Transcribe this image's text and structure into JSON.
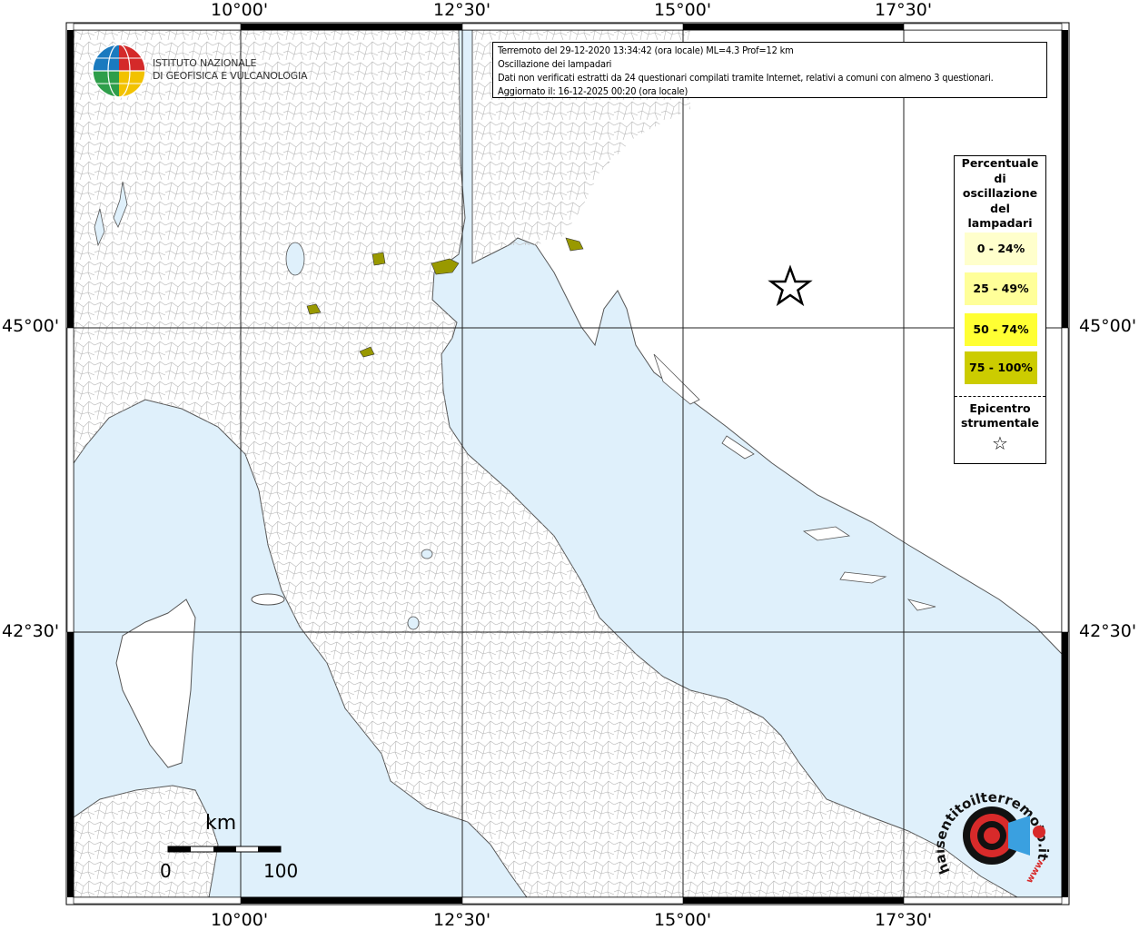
{
  "map": {
    "axis_labels": {
      "top": [
        "10°00'",
        "12°30'",
        "15°00'",
        "17°30'"
      ],
      "bottom": [
        "10°00'",
        "12°30'",
        "15°00'",
        "17°30'"
      ],
      "left": [
        "45°00'",
        "42°30'"
      ],
      "right": [
        "45°00'",
        "42°30'"
      ]
    },
    "colors": {
      "sea": "#dff0fb",
      "land": "#ffffff",
      "class_0_24": "#ffffcc",
      "class_25_49": "#ffff99",
      "class_50_74": "#ffff33",
      "class_75_100": "#cccc00",
      "affected_area": "#999900"
    }
  },
  "info": {
    "line1": "Terremoto del 29-12-2020 13:34:42 (ora locale) ML=4.3 Prof=12 km",
    "line2": "Oscillazione dei lampadari",
    "line3": "Dati non verificati estratti da 24 questionari compilati tramite Internet, relativi a comuni con almeno 3 questionari.",
    "line4": "Aggiornato il: 16-12-2025 00:20 (ora locale)"
  },
  "logo": {
    "line1": "ISTITUTO NAZIONALE",
    "line2": "DI GEOFISICA E VULCANOLOGIA"
  },
  "legend": {
    "title_lines": [
      "Percentuale",
      "di",
      "oscillazione",
      "del",
      "lampadari"
    ],
    "items": [
      "0 - 24%",
      "25 - 49%",
      "50 - 74%",
      "75 - 100%"
    ],
    "epicentre_lines": [
      "Epicentro",
      "strumentale"
    ],
    "epicentre_symbol": "☆"
  },
  "scale": {
    "unit": "km",
    "min": "0",
    "max": "100"
  },
  "hs_logo": {
    "text": "haisentitoilterremoto.it",
    "www": "www."
  }
}
